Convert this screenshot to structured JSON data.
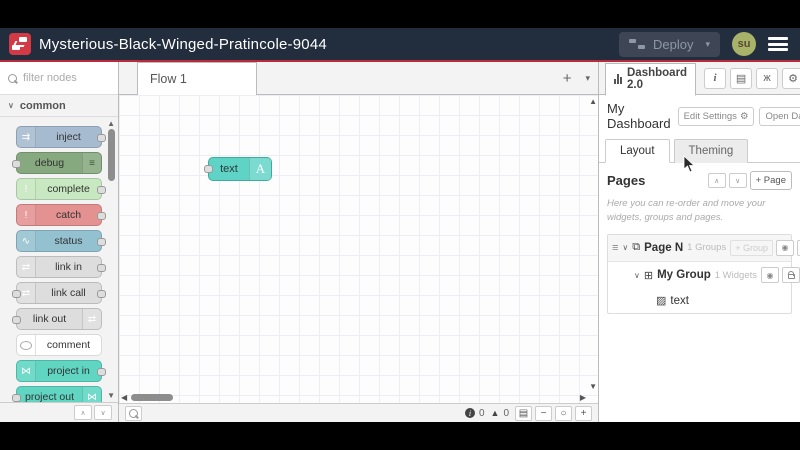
{
  "header": {
    "title": "Mysterious-Black-Winged-Pratincole-9044",
    "deploy_label": "Deploy",
    "avatar_initials": "su"
  },
  "colors": {
    "header_bg": "#222d3d",
    "accent_red": "#b92b3a",
    "logo_red": "#d43a45",
    "widget_teal": "#5ed3c6",
    "avatar_olive": "#a9b269"
  },
  "palette": {
    "search_placeholder": "filter nodes",
    "category": "common",
    "nodes": [
      {
        "label": "inject",
        "color": "#a6bbcf",
        "icon": "arrows",
        "icon_color": "#ffffff",
        "icon_side": "left",
        "port_left": false,
        "port_right": true
      },
      {
        "label": "debug",
        "color": "#87a980",
        "icon": "stripes",
        "icon_color": "#3f5938",
        "icon_side": "right",
        "port_left": true,
        "port_right": false
      },
      {
        "label": "complete",
        "color": "#c7e8c0",
        "icon": "exclaim",
        "icon_color": "#ffffff",
        "icon_side": "left",
        "port_left": false,
        "port_right": true
      },
      {
        "label": "catch",
        "color": "#e49191",
        "icon": "exclaim",
        "icon_color": "#ffffff",
        "icon_side": "left",
        "port_left": false,
        "port_right": true
      },
      {
        "label": "status",
        "color": "#94c1d0",
        "icon": "pulse",
        "icon_color": "#ffffff",
        "icon_side": "left",
        "port_left": false,
        "port_right": true
      },
      {
        "label": "link in",
        "color": "#dddddd",
        "icon": "link",
        "icon_color": "#ffffff",
        "icon_side": "left",
        "port_left": false,
        "port_right": true
      },
      {
        "label": "link call",
        "color": "#dddddd",
        "icon": "link",
        "icon_color": "#ffffff",
        "icon_side": "left",
        "port_left": true,
        "port_right": true
      },
      {
        "label": "link out",
        "color": "#dddddd",
        "icon": "link",
        "icon_color": "#ffffff",
        "icon_side": "right",
        "port_left": true,
        "port_right": false
      },
      {
        "label": "comment",
        "color": "#ffffff",
        "icon": "comment",
        "icon_color": "#aaaaaa",
        "icon_side": "left",
        "port_left": false,
        "port_right": false
      },
      {
        "label": "project in",
        "color": "#5fd5c2",
        "icon": "logo",
        "icon_color": "#ffffff",
        "icon_side": "left",
        "port_left": false,
        "port_right": true
      },
      {
        "label": "project out",
        "color": "#5fd5c2",
        "icon": "logo",
        "icon_color": "#ffffff",
        "icon_side": "right",
        "port_left": true,
        "port_right": false
      }
    ]
  },
  "canvas": {
    "tab_label": "Flow 1",
    "node": {
      "label": "text",
      "badge": "A"
    },
    "footer": {
      "info_count": "0",
      "warn_count": "0"
    }
  },
  "sidebar": {
    "tab_label": "Dashboard 2.0",
    "dashboard_title": "My Dashboard",
    "edit_settings_label": "Edit Settings",
    "open_dashboard_label": "Open Dashboard",
    "tabs": [
      "Layout",
      "Theming"
    ],
    "pages_title": "Pages",
    "add_page_label": "+ Page",
    "pages_help": "Here you can re-order and move your widgets, groups and pages.",
    "tree": {
      "page": {
        "name": "Page N",
        "count": "1 Groups",
        "add_group_label": "+ Group"
      },
      "group": {
        "name": "My Group",
        "count": "1 Widgets"
      },
      "widget": {
        "name": "text"
      }
    }
  },
  "icons": {
    "arrows": "⇉",
    "stripes": "≡",
    "exclaim": "!",
    "pulse": "∿",
    "link": "⇄",
    "logo": "⋈",
    "chevron_down": "∨",
    "chevron_up": "∧",
    "caret_down": "▾",
    "tri_up": "▲",
    "tri_down": "▼",
    "tri_left": "◀",
    "tri_right": "▶",
    "plus": "+",
    "minus": "−",
    "circle": "○",
    "drag": "≡",
    "info": "i",
    "book": "▤",
    "bug": "ж",
    "gear": "⚙",
    "page": "⧉",
    "group": "⊞",
    "image": "▨",
    "eye": "◉",
    "external": "↗",
    "warn": "▲",
    "zoom_reset": "○"
  }
}
